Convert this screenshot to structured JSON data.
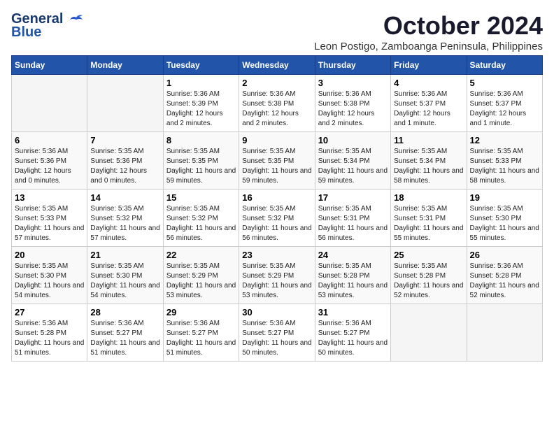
{
  "header": {
    "logo_line1": "General",
    "logo_line2": "Blue",
    "month": "October 2024",
    "location": "Leon Postigo, Zamboanga Peninsula, Philippines"
  },
  "weekdays": [
    "Sunday",
    "Monday",
    "Tuesday",
    "Wednesday",
    "Thursday",
    "Friday",
    "Saturday"
  ],
  "weeks": [
    [
      {
        "day": "",
        "sunrise": "",
        "sunset": "",
        "daylight": ""
      },
      {
        "day": "",
        "sunrise": "",
        "sunset": "",
        "daylight": ""
      },
      {
        "day": "1",
        "sunrise": "Sunrise: 5:36 AM",
        "sunset": "Sunset: 5:39 PM",
        "daylight": "Daylight: 12 hours and 2 minutes."
      },
      {
        "day": "2",
        "sunrise": "Sunrise: 5:36 AM",
        "sunset": "Sunset: 5:38 PM",
        "daylight": "Daylight: 12 hours and 2 minutes."
      },
      {
        "day": "3",
        "sunrise": "Sunrise: 5:36 AM",
        "sunset": "Sunset: 5:38 PM",
        "daylight": "Daylight: 12 hours and 2 minutes."
      },
      {
        "day": "4",
        "sunrise": "Sunrise: 5:36 AM",
        "sunset": "Sunset: 5:37 PM",
        "daylight": "Daylight: 12 hours and 1 minute."
      },
      {
        "day": "5",
        "sunrise": "Sunrise: 5:36 AM",
        "sunset": "Sunset: 5:37 PM",
        "daylight": "Daylight: 12 hours and 1 minute."
      }
    ],
    [
      {
        "day": "6",
        "sunrise": "Sunrise: 5:36 AM",
        "sunset": "Sunset: 5:36 PM",
        "daylight": "Daylight: 12 hours and 0 minutes."
      },
      {
        "day": "7",
        "sunrise": "Sunrise: 5:35 AM",
        "sunset": "Sunset: 5:36 PM",
        "daylight": "Daylight: 12 hours and 0 minutes."
      },
      {
        "day": "8",
        "sunrise": "Sunrise: 5:35 AM",
        "sunset": "Sunset: 5:35 PM",
        "daylight": "Daylight: 11 hours and 59 minutes."
      },
      {
        "day": "9",
        "sunrise": "Sunrise: 5:35 AM",
        "sunset": "Sunset: 5:35 PM",
        "daylight": "Daylight: 11 hours and 59 minutes."
      },
      {
        "day": "10",
        "sunrise": "Sunrise: 5:35 AM",
        "sunset": "Sunset: 5:34 PM",
        "daylight": "Daylight: 11 hours and 59 minutes."
      },
      {
        "day": "11",
        "sunrise": "Sunrise: 5:35 AM",
        "sunset": "Sunset: 5:34 PM",
        "daylight": "Daylight: 11 hours and 58 minutes."
      },
      {
        "day": "12",
        "sunrise": "Sunrise: 5:35 AM",
        "sunset": "Sunset: 5:33 PM",
        "daylight": "Daylight: 11 hours and 58 minutes."
      }
    ],
    [
      {
        "day": "13",
        "sunrise": "Sunrise: 5:35 AM",
        "sunset": "Sunset: 5:33 PM",
        "daylight": "Daylight: 11 hours and 57 minutes."
      },
      {
        "day": "14",
        "sunrise": "Sunrise: 5:35 AM",
        "sunset": "Sunset: 5:32 PM",
        "daylight": "Daylight: 11 hours and 57 minutes."
      },
      {
        "day": "15",
        "sunrise": "Sunrise: 5:35 AM",
        "sunset": "Sunset: 5:32 PM",
        "daylight": "Daylight: 11 hours and 56 minutes."
      },
      {
        "day": "16",
        "sunrise": "Sunrise: 5:35 AM",
        "sunset": "Sunset: 5:32 PM",
        "daylight": "Daylight: 11 hours and 56 minutes."
      },
      {
        "day": "17",
        "sunrise": "Sunrise: 5:35 AM",
        "sunset": "Sunset: 5:31 PM",
        "daylight": "Daylight: 11 hours and 56 minutes."
      },
      {
        "day": "18",
        "sunrise": "Sunrise: 5:35 AM",
        "sunset": "Sunset: 5:31 PM",
        "daylight": "Daylight: 11 hours and 55 minutes."
      },
      {
        "day": "19",
        "sunrise": "Sunrise: 5:35 AM",
        "sunset": "Sunset: 5:30 PM",
        "daylight": "Daylight: 11 hours and 55 minutes."
      }
    ],
    [
      {
        "day": "20",
        "sunrise": "Sunrise: 5:35 AM",
        "sunset": "Sunset: 5:30 PM",
        "daylight": "Daylight: 11 hours and 54 minutes."
      },
      {
        "day": "21",
        "sunrise": "Sunrise: 5:35 AM",
        "sunset": "Sunset: 5:30 PM",
        "daylight": "Daylight: 11 hours and 54 minutes."
      },
      {
        "day": "22",
        "sunrise": "Sunrise: 5:35 AM",
        "sunset": "Sunset: 5:29 PM",
        "daylight": "Daylight: 11 hours and 53 minutes."
      },
      {
        "day": "23",
        "sunrise": "Sunrise: 5:35 AM",
        "sunset": "Sunset: 5:29 PM",
        "daylight": "Daylight: 11 hours and 53 minutes."
      },
      {
        "day": "24",
        "sunrise": "Sunrise: 5:35 AM",
        "sunset": "Sunset: 5:28 PM",
        "daylight": "Daylight: 11 hours and 53 minutes."
      },
      {
        "day": "25",
        "sunrise": "Sunrise: 5:35 AM",
        "sunset": "Sunset: 5:28 PM",
        "daylight": "Daylight: 11 hours and 52 minutes."
      },
      {
        "day": "26",
        "sunrise": "Sunrise: 5:36 AM",
        "sunset": "Sunset: 5:28 PM",
        "daylight": "Daylight: 11 hours and 52 minutes."
      }
    ],
    [
      {
        "day": "27",
        "sunrise": "Sunrise: 5:36 AM",
        "sunset": "Sunset: 5:28 PM",
        "daylight": "Daylight: 11 hours and 51 minutes."
      },
      {
        "day": "28",
        "sunrise": "Sunrise: 5:36 AM",
        "sunset": "Sunset: 5:27 PM",
        "daylight": "Daylight: 11 hours and 51 minutes."
      },
      {
        "day": "29",
        "sunrise": "Sunrise: 5:36 AM",
        "sunset": "Sunset: 5:27 PM",
        "daylight": "Daylight: 11 hours and 51 minutes."
      },
      {
        "day": "30",
        "sunrise": "Sunrise: 5:36 AM",
        "sunset": "Sunset: 5:27 PM",
        "daylight": "Daylight: 11 hours and 50 minutes."
      },
      {
        "day": "31",
        "sunrise": "Sunrise: 5:36 AM",
        "sunset": "Sunset: 5:27 PM",
        "daylight": "Daylight: 11 hours and 50 minutes."
      },
      {
        "day": "",
        "sunrise": "",
        "sunset": "",
        "daylight": ""
      },
      {
        "day": "",
        "sunrise": "",
        "sunset": "",
        "daylight": ""
      }
    ]
  ]
}
